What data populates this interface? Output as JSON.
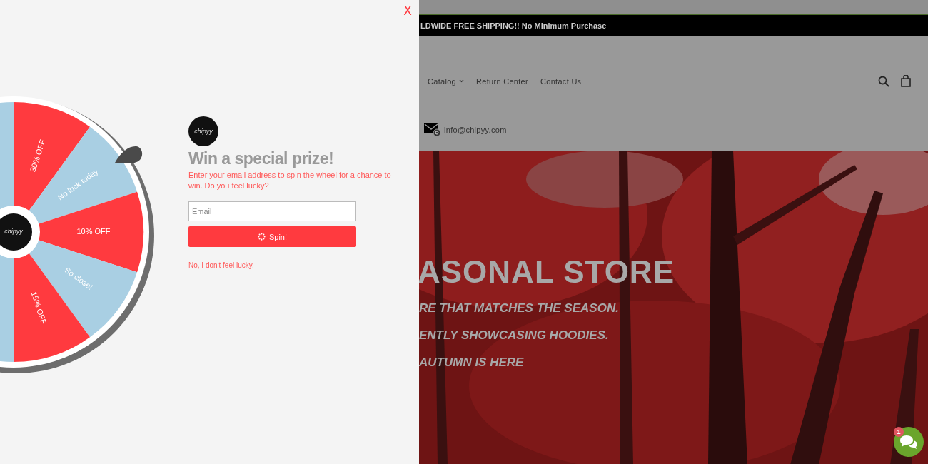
{
  "popup": {
    "close": "X",
    "wheel": {
      "hub_logo": "chipyy",
      "segments": [
        {
          "color": "#a9cfe3"
        },
        {
          "label": "30% OFF",
          "color": "#ff3a3f"
        },
        {
          "label": "No luck today",
          "color": "#a9cfe3"
        },
        {
          "label": "10% OFF",
          "color": "#ff3a3f"
        },
        {
          "label": "So close!",
          "color": "#a9cfe3"
        },
        {
          "label": "15% OFF",
          "color": "#ff3a3f"
        },
        {
          "color": "#a9cfe3"
        }
      ]
    },
    "logo": "chipyy",
    "title": "Win a special prize!",
    "description": "Enter your email address to spin the wheel for a chance to win. Do you feel lucky?",
    "email_field": {
      "placeholder": "Email"
    },
    "spin_button": "Spin!",
    "decline_link": "No, I don't feel lucky."
  },
  "page": {
    "announcement": "LDWIDE FREE SHIPPING!! No Minimum Purchase",
    "nav": [
      {
        "label": "Catalog",
        "dropdown": true
      },
      {
        "label": "Return Center",
        "dropdown": false
      },
      {
        "label": "Contact Us",
        "dropdown": false
      }
    ],
    "contact_email": "info@chipyy.com",
    "hero": {
      "title": "ASONAL STORE",
      "lines": [
        "RE THAT MATCHES THE SEASON.",
        "ENTLY SHOWCASING HOODIES.",
        "AUTUMN IS HERE"
      ]
    },
    "chat": {
      "badge": "1"
    }
  }
}
